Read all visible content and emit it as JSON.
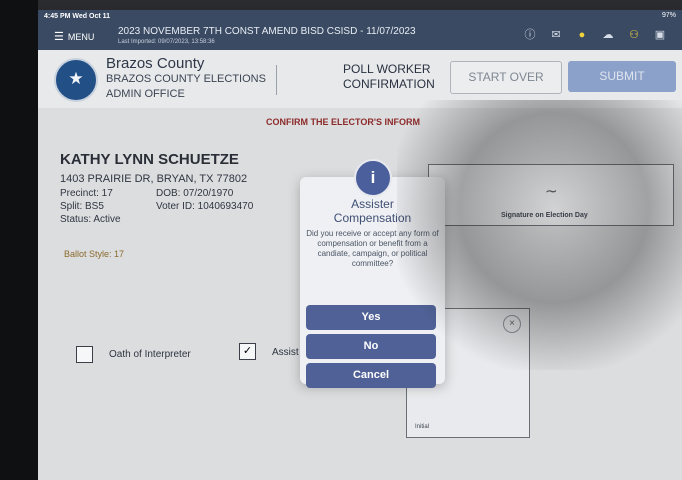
{
  "status_bar": {
    "time": "4:45 PM  Wed Oct 11",
    "battery": "97%"
  },
  "top_bar": {
    "menu_label": "MENU",
    "election_title": "2023 NOVEMBER 7TH CONST AMEND BISD CSISD  - 11/07/2023",
    "last_imported": "Last Imported: 09/07/2023, 13:58:36"
  },
  "header": {
    "county_name": "Brazos County",
    "county_line2": "BRAZOS COUNTY ELECTIONS",
    "county_line3": "ADMIN OFFICE",
    "page_title_line1": "POLL WORKER",
    "page_title_line2": "CONFIRMATION",
    "start_over_label": "START OVER",
    "submit_label": "SUBMIT"
  },
  "banner": {
    "confirm_text": "CONFIRM THE ELECTOR'S INFORM"
  },
  "voter": {
    "name": "KATHY LYNN SCHUETZE",
    "address": "1403 PRAIRIE DR, BRYAN, TX 77802",
    "precinct": "Precinct: 17",
    "dob": "DOB: 07/20/1970",
    "split": "Split: BS5",
    "voter_id": "Voter ID: 1040693470",
    "status": "Status: Active",
    "ballot_style": "Ballot Style: 17"
  },
  "signature": {
    "label": "Signature on Election Day"
  },
  "initial": {
    "label": "Initial"
  },
  "checkboxes": {
    "oath_label": "Oath of Interpreter",
    "assister_label": "Assist"
  },
  "modal": {
    "icon": "i",
    "title_line1": "Assister",
    "title_line2": "Compensation",
    "question": "Did you receive or accept any form of compensation or benefit from a candiate, campaign, or political committee?",
    "yes_label": "Yes",
    "no_label": "No",
    "cancel_label": "Cancel"
  },
  "icons": {
    "menu": "hamburger-icon",
    "info": "info-icon",
    "mail": "mail-icon",
    "alert": "alert-icon",
    "cloud": "cloud-icon",
    "users": "users-icon",
    "chat": "chat-icon"
  }
}
